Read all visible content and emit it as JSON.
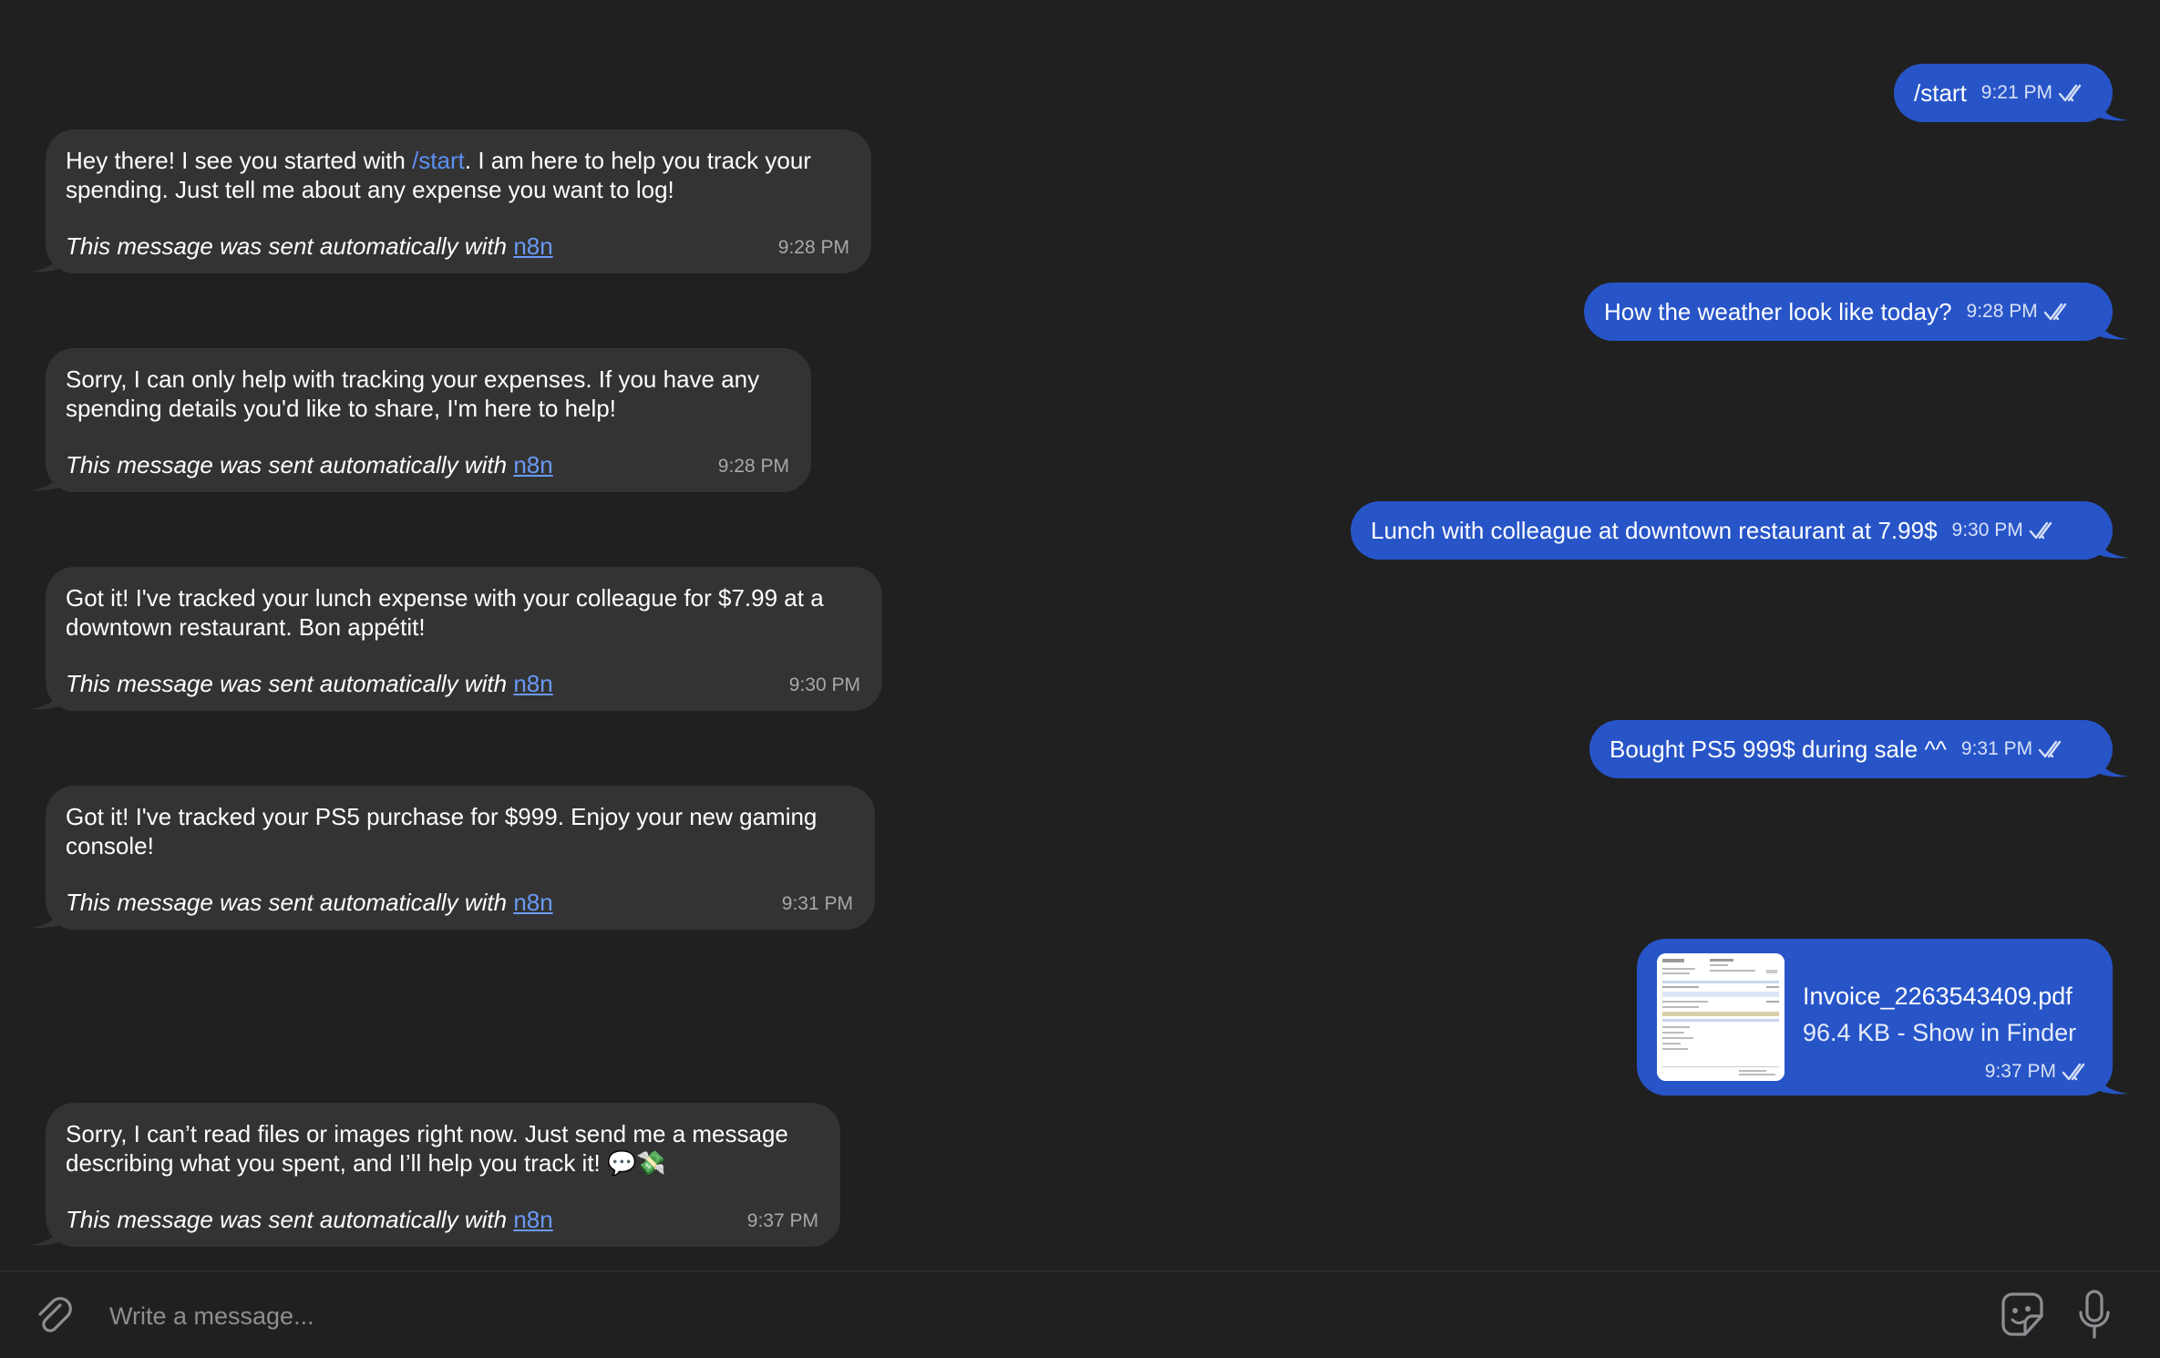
{
  "messages": {
    "m1": {
      "text": "/start",
      "time": "9:21 PM"
    },
    "m2": {
      "text_before": "Hey there! I see you started with ",
      "command": "/start",
      "text_after": ". I am here to help you track your spending. Just tell me about any expense you want to log!",
      "auto_text": "This message was sent automatically with ",
      "auto_link": "n8n",
      "time": "9:28 PM"
    },
    "m3": {
      "text": "How the weather look like today?",
      "time": "9:28 PM"
    },
    "m4": {
      "text": "Sorry, I can only help with tracking your expenses. If you have any spending details you'd like to share, I'm here to help!",
      "auto_text": "This message was sent automatically with ",
      "auto_link": "n8n",
      "time": "9:28 PM"
    },
    "m5": {
      "text": "Lunch with colleague at downtown restaurant at 7.99$",
      "time": "9:30 PM"
    },
    "m6": {
      "text": "Got it! I've tracked your lunch expense with your colleague for $7.99 at a downtown restaurant. Bon appétit!",
      "auto_text": "This message was sent automatically with ",
      "auto_link": "n8n",
      "time": "9:30 PM"
    },
    "m7": {
      "text": "Bought PS5 999$ during sale ^^",
      "time": "9:31 PM"
    },
    "m8": {
      "text": "Got it! I've tracked your PS5 purchase for $999. Enjoy your new gaming console!",
      "auto_text": "This message was sent automatically with ",
      "auto_link": "n8n",
      "time": "9:31 PM"
    },
    "m9": {
      "file_name": "Invoice_2263543409.pdf",
      "file_info": "96.4 KB - Show in Finder",
      "time": "9:37 PM"
    },
    "m10": {
      "text": "Sorry, I can’t read files or images right now. Just send me a message describing what you spent, and I’ll help you track it! 💬💸",
      "auto_text": "This message was sent automatically with ",
      "auto_link": "n8n",
      "time": "9:37 PM"
    }
  },
  "composer": {
    "placeholder": "Write a message..."
  },
  "colors": {
    "background": "#202021",
    "incoming_bubble": "#333334",
    "outgoing_bubble": "#2755c8",
    "link": "#6a9af5"
  },
  "icons": [
    "attach-icon",
    "sticker-icon",
    "microphone-icon",
    "read-receipt-icon"
  ]
}
